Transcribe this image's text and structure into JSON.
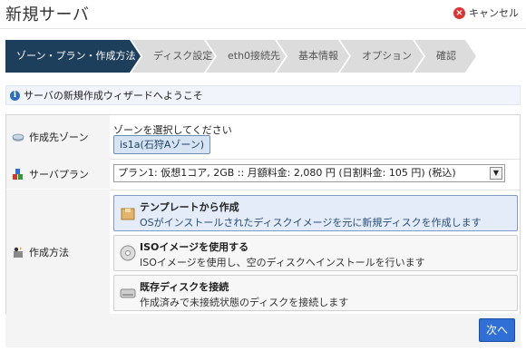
{
  "header": {
    "title": "新規サーバ",
    "cancel_label": "キャンセル"
  },
  "steps": [
    {
      "label": "ゾーン・プラン・作成方法",
      "active": true
    },
    {
      "label": "ディスク設定",
      "active": false
    },
    {
      "label": "eth0接続先",
      "active": false
    },
    {
      "label": "基本情報",
      "active": false
    },
    {
      "label": "オプション",
      "active": false
    },
    {
      "label": "確認",
      "active": false
    }
  ],
  "info": {
    "text": "サーバの新規作成ウィザードへようこそ"
  },
  "zone": {
    "label": "作成先ゾーン",
    "prompt": "ゾーンを選択してください",
    "selected": "is1a(石狩Aゾーン)"
  },
  "plan": {
    "label": "サーバプラン",
    "selected": "プラン1: 仮想1コア, 2GB :: 月額料金: 2,080 円 (日割料金: 105 円) (税込)"
  },
  "method": {
    "label": "作成方法",
    "options": [
      {
        "title": "テンプレートから作成",
        "desc": "OSがインストールされたディスクイメージを元に新規ディスクを作成します",
        "selected": true,
        "icon": "template-box-icon"
      },
      {
        "title": "ISOイメージを使用する",
        "desc": "ISOイメージを使用し、空のディスクへインストールを行います",
        "selected": false,
        "icon": "cd-disc-icon"
      },
      {
        "title": "既存ディスクを接続",
        "desc": "作成済みで未接続状態のディスクを接続します",
        "selected": false,
        "icon": "disk-drive-icon"
      }
    ]
  },
  "footer": {
    "next_label": "次へ"
  },
  "colors": {
    "active_step": "#1d3f5c",
    "inactive_step": "#dcdcdc",
    "next_button": "#2f6fd6",
    "selected_option": "#e3ecf8"
  }
}
